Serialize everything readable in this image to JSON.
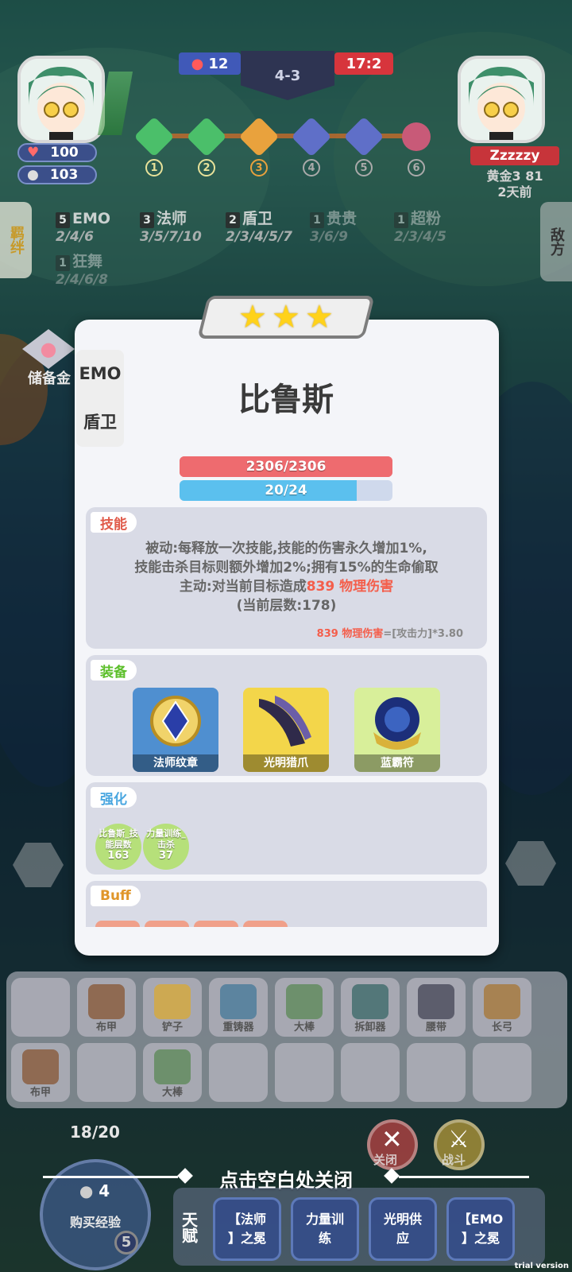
{
  "top": {
    "left_score": "12",
    "stage": "4-3",
    "right_score": "17:2",
    "left_player": {
      "hp": "100",
      "coins": "103"
    },
    "right_player": {
      "name": "Zzzzzy",
      "gold_line": "黄金3 81",
      "time": "2天前"
    },
    "stages": [
      "1",
      "2",
      "3",
      "4",
      "5",
      "6"
    ]
  },
  "side": {
    "left_tab": "羁绊",
    "right_tab": "敌方",
    "piggy_label": "储备金"
  },
  "traits": [
    {
      "count": "5",
      "name": "EMO",
      "levels": "2/4/6"
    },
    {
      "count": "3",
      "name": "法师",
      "levels": "3/5/7/10"
    },
    {
      "count": "2",
      "name": "盾卫",
      "levels": "2/3/4/5/7"
    },
    {
      "count": "1",
      "name": "贵贵",
      "levels": "3/6/9"
    },
    {
      "count": "1",
      "name": "超粉",
      "levels": "2/3/4/5"
    },
    {
      "count": "1",
      "name": "狂舞",
      "levels": "2/4/6/8"
    }
  ],
  "hero": {
    "tags": [
      "EMO",
      "盾卫"
    ],
    "name": "比鲁斯",
    "hp_text": "2306/2306",
    "hp_fraction": 1.0,
    "mana_text": "20/24",
    "mana_fraction": 0.833,
    "skill_label": "技能",
    "skill_line1": "被动:每释放一次技能,技能的伤害永久增加1%,",
    "skill_line2": "技能击杀目标则额外增加2%;拥有15%的生命偷取",
    "skill_line3_prefix": "主动:对当前目标造成",
    "skill_line3_damage": "839 物理伤害",
    "skill_line4": "(当前层数:178)",
    "formula_damage": "839 物理伤害",
    "formula_rest": "=[攻击力]*3.80",
    "equip_label": "装备",
    "equips": [
      "法师纹章",
      "光明猎爪",
      "蓝霸符"
    ],
    "enhance_label": "强化",
    "enhances": [
      {
        "name": "比鲁斯_技能层数",
        "value": "163"
      },
      {
        "name": "力量训练_击杀",
        "value": "37"
      }
    ],
    "buff_label": "Buff"
  },
  "inventory": {
    "row1": [
      "",
      "布甲",
      "铲子",
      "重铸器",
      "大棒",
      "拆卸器",
      "腰带",
      "长弓"
    ],
    "row2": [
      "布甲",
      "",
      "大棒",
      "",
      "",
      "",
      "",
      ""
    ]
  },
  "bottom": {
    "close_hint": "点击空白处关闭",
    "exp": "18/20",
    "buy_cost": "4",
    "buy_label": "购买经验",
    "level": "5",
    "close_btn": "关闭",
    "fight_btn": "战斗",
    "talent_tab": "天赋",
    "talents": [
      "【法师\n】之冕",
      "力量训\n练",
      "光明供\n应",
      "【EMO\n】之冕"
    ]
  },
  "watermark": "trial version",
  "colors": {
    "hp": "#ee6b6f",
    "mana": "#5bc0ee",
    "damage": "#f45e4b",
    "star": "#ffd21a"
  }
}
